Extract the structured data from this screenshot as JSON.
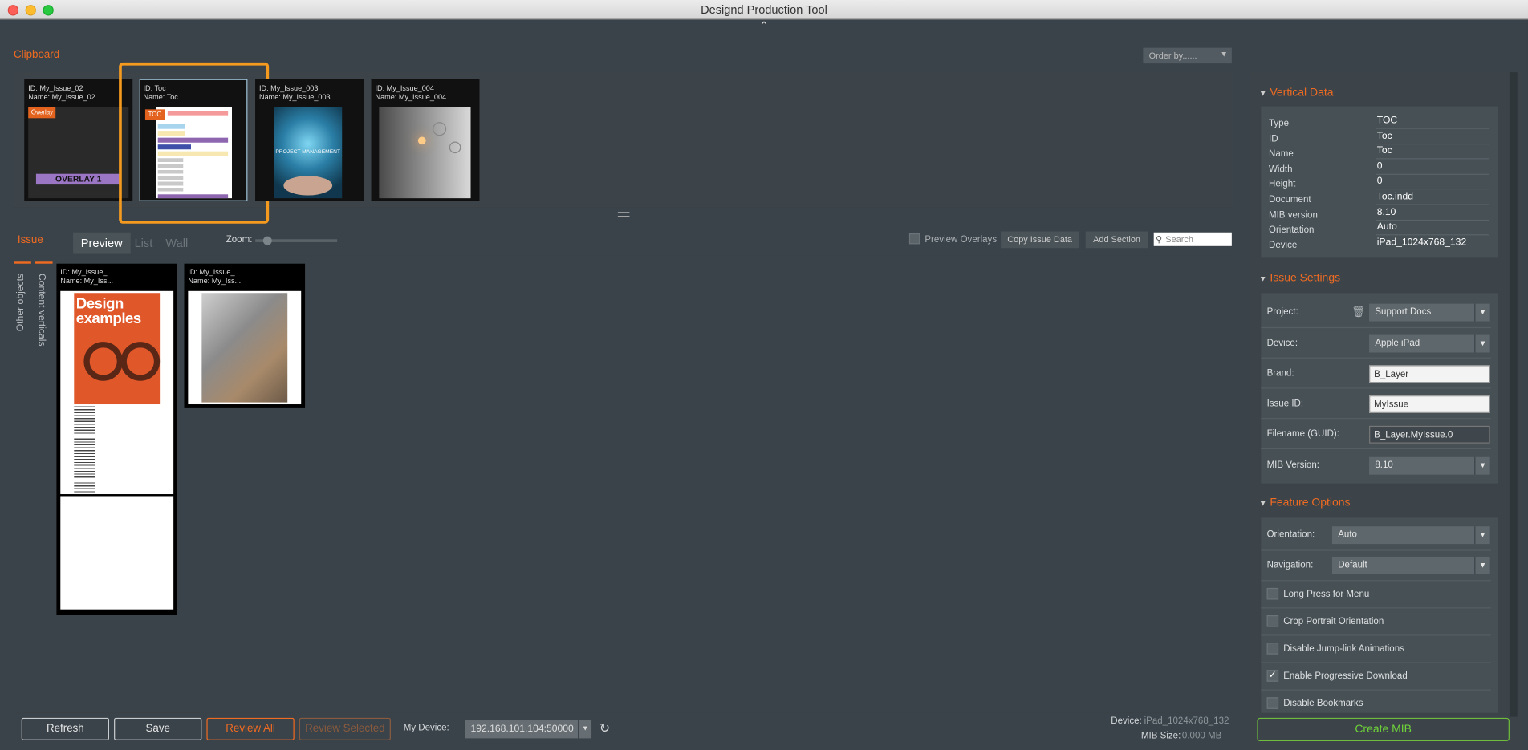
{
  "window": {
    "title": "Designd Production Tool"
  },
  "clipboard": {
    "title": "Clipboard",
    "order_by": "Order by......",
    "items": [
      {
        "id": "ID: My_Issue_02",
        "name": "Name: My_Issue_02",
        "tag": "Overlay",
        "overlay_text": "OVERLAY 1"
      },
      {
        "id": "ID: Toc",
        "name": "Name: Toc",
        "tag": "TOC"
      },
      {
        "id": "ID: My_Issue_003",
        "name": "Name: My_Issue_003",
        "art_text": "PROJECT MANAGEMENT"
      },
      {
        "id": "ID: My_Issue_004",
        "name": "Name: My_Issue_004"
      }
    ]
  },
  "issue": {
    "title": "Issue",
    "tabs": [
      "Preview",
      "List",
      "Wall"
    ],
    "zoom_label": "Zoom:",
    "zoom_level": 0.1,
    "preview_overlays": "Preview Overlays",
    "copy_issue_data": "Copy Issue Data",
    "add_section": "Add Section",
    "search_placeholder": "Search",
    "side_tabs": [
      "Content verticals",
      "Other objects"
    ],
    "pages": [
      {
        "id": "ID: My_Issue_...",
        "name": "Name: My_Iss...",
        "headline": "Design examples"
      },
      {
        "id": "ID: My_Issue_...",
        "name": "Name: My_Iss..."
      }
    ]
  },
  "bottom": {
    "refresh": "Refresh",
    "save": "Save",
    "review_all": "Review All",
    "review_selected": "Review Selected",
    "my_device_label": "My Device:",
    "my_device_value": "192.168.101.104:50000",
    "device_label": "Device:",
    "device_value": "iPad_1024x768_132",
    "mib_size_label": "MIB Size:",
    "mib_size_value": "0.000 MB"
  },
  "vertical_data": {
    "title": "Vertical Data",
    "rows": [
      {
        "k": "Type",
        "v": "TOC"
      },
      {
        "k": "ID",
        "v": "Toc"
      },
      {
        "k": "Name",
        "v": "Toc"
      },
      {
        "k": "Width",
        "v": "0"
      },
      {
        "k": "Height",
        "v": "0"
      },
      {
        "k": "Document",
        "v": "Toc.indd"
      },
      {
        "k": "MIB version",
        "v": "8.10"
      },
      {
        "k": "Orientation",
        "v": "Auto"
      },
      {
        "k": "Device",
        "v": "iPad_1024x768_132"
      }
    ]
  },
  "issue_settings": {
    "title": "Issue Settings",
    "project_label": "Project:",
    "project_value": "Support Docs",
    "device_label": "Device:",
    "device_value": "Apple iPad",
    "brand_label": "Brand:",
    "brand_value": "B_Layer",
    "issue_id_label": "Issue ID:",
    "issue_id_value": "MyIssue",
    "filename_label": "Filename (GUID):",
    "filename_value": "B_Layer.MyIssue.0",
    "mib_version_label": "MIB Version:",
    "mib_version_value": "8.10"
  },
  "feature_options": {
    "title": "Feature Options",
    "orientation_label": "Orientation:",
    "orientation_value": "Auto",
    "navigation_label": "Navigation:",
    "navigation_value": "Default",
    "checkboxes": [
      {
        "label": "Long Press for Menu",
        "checked": false
      },
      {
        "label": "Crop Portrait Orientation",
        "checked": false
      },
      {
        "label": "Disable Jump-link Animations",
        "checked": false
      },
      {
        "label": "Enable Progressive Download",
        "checked": true
      },
      {
        "label": "Disable Bookmarks",
        "checked": false
      }
    ]
  },
  "create_mib": "Create MIB",
  "colors": {
    "accent": "#f06b22",
    "create": "#6fd33a",
    "selection": "#f49a1f"
  }
}
